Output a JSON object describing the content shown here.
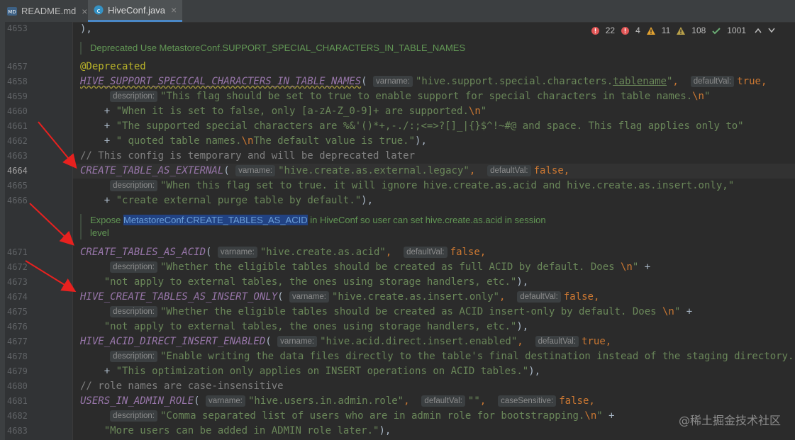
{
  "tabs": [
    {
      "label": "README.md",
      "icon": "markdown-file-icon",
      "active": false
    },
    {
      "label": "HiveConf.java",
      "icon": "java-class-icon",
      "active": true
    }
  ],
  "inspections": {
    "errors": "22",
    "errors2": "4",
    "warnings": "11",
    "weak_warnings": "108",
    "typos": "1001"
  },
  "line_numbers": [
    "4653",
    "4657",
    "4658",
    "4659",
    "4660",
    "4661",
    "4662",
    "4663",
    "4664",
    "4665",
    "4666",
    "4671",
    "4672",
    "4673",
    "4674",
    "4675",
    "4676",
    "4677",
    "4678",
    "4679",
    "4680",
    "4681",
    "4682",
    "4683"
  ],
  "hints": {
    "varname": "varname:",
    "defaultVal": "defaultVal:",
    "description": "description:",
    "caseSensitive": "caseSensitive:"
  },
  "doc1": {
    "text": "Deprecated Use MetastoreConf.SUPPORT_SPECIAL_CHARACTERS_IN_TABLE_NAMES"
  },
  "doc2": {
    "pre": "Expose ",
    "link": "MetastoreConf.CREATE_TABLES_AS_ACID",
    "post": " in HiveConf so user can set hive.create.as.acid in session",
    "line2": "level"
  },
  "code": {
    "l4653": "),",
    "l4657": "@Deprecated",
    "l4658_name": "HIVE_SUPPORT_SPECICAL_CHARACTERS_IN_TABLE_NAMES",
    "l4658_s1": "\"hive.support.special.characters.",
    "l4658_s2": "tablename",
    "l4658_s3": "\"",
    "l4659_s": "\"This flag should be set to true to enable support for special characters in table names.",
    "l4660_s": "\"When it is set to false, only [a-zA-Z_0-9]+ are supported.",
    "l4661_s": "\"The supported special characters are %&'()*+,-./:;<=>?[]_|{}$^!~#@ and space. This flag applies only to\"",
    "l4662_s1": "\" quoted table names.",
    "l4662_s2": "The default value is true.\"",
    "l4663": "// This config is temporary and will be deprecated later",
    "l4664_name": "CREATE_TABLE_AS_EXTERNAL",
    "l4664_s": "\"hive.create.as.external.legacy\"",
    "l4665_s": "\"When this flag set to true. it will ignore hive.create.as.acid and hive.create.as.insert.only,\"",
    "l4666_s": "\"create external purge table by default.\"",
    "l4671_name": "CREATE_TABLES_AS_ACID",
    "l4671_s": "\"hive.create.as.acid\"",
    "l4672_s": "\"Whether the eligible tables should be created as full ACID by default. Does ",
    "l4673_s": "\"not apply to external tables, the ones using storage handlers, etc.\"",
    "l4674_name": "HIVE_CREATE_TABLES_AS_INSERT_ONLY",
    "l4674_s": "\"hive.create.as.insert.only\"",
    "l4675_s": "\"Whether the eligible tables should be created as ACID insert-only by default. Does ",
    "l4676_s": "\"not apply to external tables, the ones using storage handlers, etc.\"",
    "l4677_name": "HIVE_ACID_DIRECT_INSERT_ENABLED",
    "l4677_s": "\"hive.acid.direct.insert.enabled\"",
    "l4678_s": "\"Enable writing the data files directly to the table's final destination instead of the staging directory.\"",
    "l4679_s": "\"This optimization only applies on INSERT operations on ACID tables.\"",
    "l4680": "// role names are case-insensitive",
    "l4681_name": "USERS_IN_ADMIN_ROLE",
    "l4681_s1": "\"hive.users.in.admin.role\"",
    "l4681_s2": "\"\"",
    "l4682_s": "\"Comma separated list of users who are in admin role for bootstrapping.",
    "l4683_s": "\"More users can be added in ADMIN role later.\"",
    "kw_true": "true",
    "kw_false": "false",
    "esc_n": "\\n",
    "q": "\"",
    "plus": "+",
    "comma": ",",
    "close": "),",
    "open": "(",
    "close_paren": ")"
  },
  "watermark": "@稀土掘金技术社区",
  "colors": {
    "accent": "#4a88c7",
    "background": "#2b2b2b",
    "arrow": "#e8211f"
  }
}
